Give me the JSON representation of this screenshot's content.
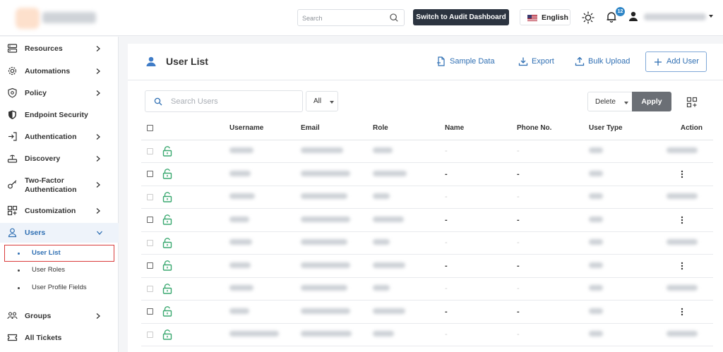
{
  "header": {
    "search_placeholder": "Search",
    "audit_button": "Switch to Audit Dashboard",
    "language": "English",
    "notification_count": "12"
  },
  "sidebar": {
    "items": [
      {
        "label": "Resources",
        "icon": "resources-icon"
      },
      {
        "label": "Automations",
        "icon": "gear-icon"
      },
      {
        "label": "Policy",
        "icon": "policy-shield-icon"
      },
      {
        "label": "Endpoint Security",
        "icon": "shield-icon"
      },
      {
        "label": "Authentication",
        "icon": "login-icon"
      },
      {
        "label": "Discovery",
        "icon": "discovery-icon"
      },
      {
        "label": "Two-Factor Authentication",
        "icon": "key-icon"
      },
      {
        "label": "Customization",
        "icon": "customize-icon"
      },
      {
        "label": "Users",
        "icon": "user-icon"
      },
      {
        "label": "Groups",
        "icon": "groups-icon"
      },
      {
        "label": "All Tickets",
        "icon": "ticket-icon"
      }
    ],
    "users_sub": [
      "User List",
      "User Roles",
      "User Profile Fields"
    ]
  },
  "page": {
    "title": "User List",
    "actions": {
      "sample_data": "Sample Data",
      "export": "Export",
      "bulk_upload": "Bulk Upload",
      "add_user": "Add User"
    },
    "search_placeholder": "Search Users",
    "filter_value": "All",
    "bulk_action_value": "Delete",
    "apply_label": "Apply"
  },
  "table": {
    "columns": [
      "Username",
      "Email",
      "Role",
      "Name",
      "Phone No.",
      "User Type",
      "Action"
    ],
    "rows": [
      {
        "name": "-",
        "phone": "-",
        "muted": true
      },
      {
        "name": "-",
        "phone": "-",
        "muted": false
      },
      {
        "name": "-",
        "phone": "-",
        "muted": true
      },
      {
        "name": "-",
        "phone": "-",
        "muted": false
      },
      {
        "name": "-",
        "phone": "-",
        "muted": true
      },
      {
        "name": "-",
        "phone": "-",
        "muted": false
      },
      {
        "name": "-",
        "phone": "-",
        "muted": true
      },
      {
        "name": "-",
        "phone": "-",
        "muted": false
      },
      {
        "name": "-",
        "phone": "-",
        "muted": true
      }
    ]
  },
  "colors": {
    "accent": "#2f6fb3",
    "dark_button": "#2c3440",
    "lock_green": "#3aa870",
    "highlight_red": "#d93b3b"
  }
}
